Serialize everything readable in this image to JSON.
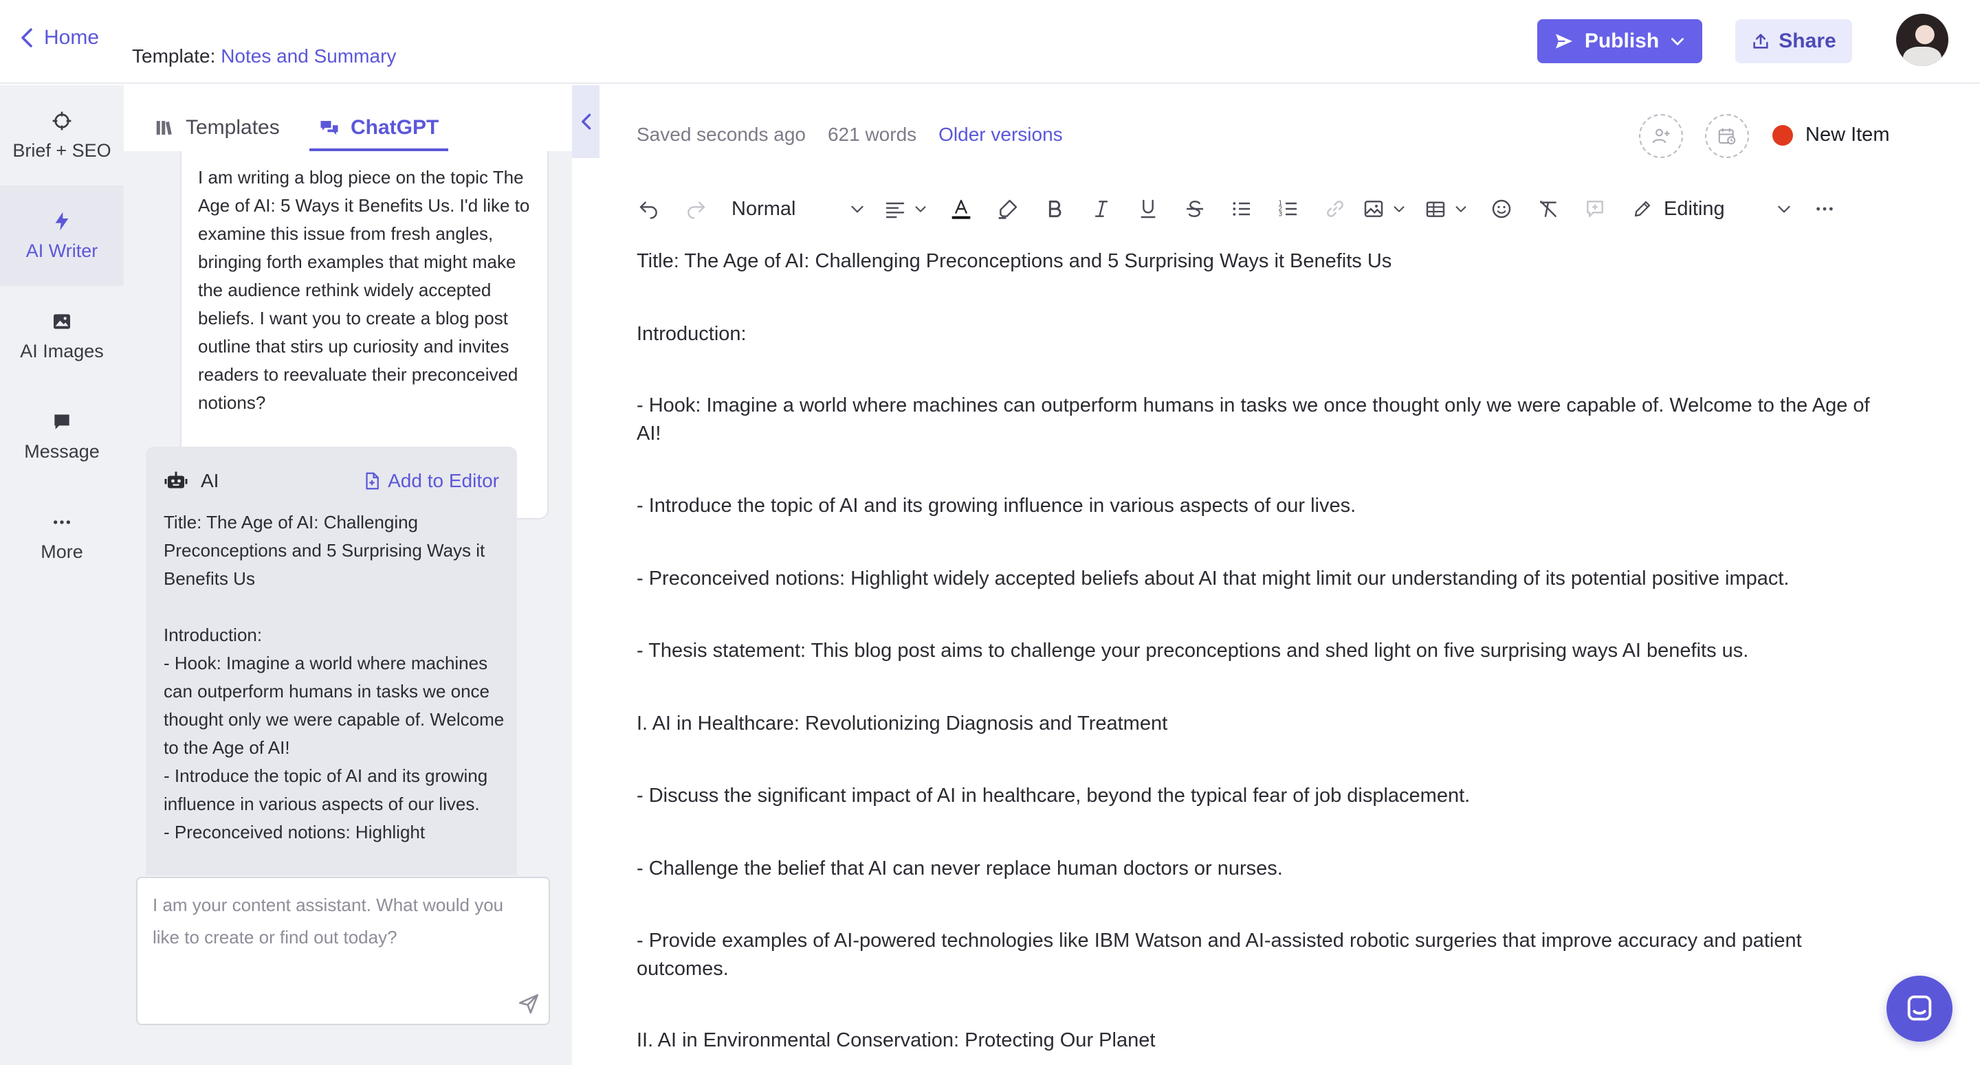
{
  "header": {
    "home_label": "Home",
    "template_prefix": "Template:",
    "template_name": "Notes and Summary",
    "publish_label": "Publish",
    "share_label": "Share"
  },
  "rail": {
    "items": [
      {
        "label": "Brief + SEO",
        "icon": "crosshair-icon"
      },
      {
        "label": "AI Writer",
        "icon": "lightning-icon"
      },
      {
        "label": "AI Images",
        "icon": "image-icon"
      },
      {
        "label": "Message",
        "icon": "message-icon"
      },
      {
        "label": "More",
        "icon": "more-dots-icon"
      }
    ]
  },
  "panel": {
    "tabs": [
      {
        "label": "Templates",
        "icon": "library-icon"
      },
      {
        "label": "ChatGPT",
        "icon": "chat-icon"
      }
    ],
    "user_message": "I am writing a blog piece on the topic The Age of AI: 5 Ways it Benefits Us. I'd like to examine this issue from fresh angles, bringing forth examples that might make the audience rethink widely accepted beliefs. I want you to create a blog post outline that stirs up curiosity and invites readers to reevaluate their preconceived notions?",
    "ai_label": "AI",
    "add_to_editor_label": "Add to Editor",
    "ai_message": "Title: The Age of AI: Challenging Preconceptions and 5 Surprising Ways it Benefits Us\n\nIntroduction:\n- Hook: Imagine a world where machines can outperform humans in tasks we once thought only we were capable of. Welcome to the Age of AI!\n- Introduce the topic of AI and its growing influence in various aspects of our lives.\n- Preconceived notions: Highlight",
    "input_placeholder": "I am your content assistant. What would you like to create or find out today?"
  },
  "editor": {
    "saved_status": "Saved seconds ago",
    "word_count": "621 words",
    "older_versions_label": "Older versions",
    "item_status_label": "New Item",
    "item_status_color": "#e0391d",
    "block_style": "Normal",
    "mode": "Editing",
    "doc_paragraphs": [
      "Title: The Age of AI: Challenging Preconceptions and 5 Surprising Ways it Benefits Us",
      "Introduction:",
      "- Hook: Imagine a world where machines can outperform humans in tasks we once thought only we were capable of. Welcome to the Age of AI!",
      "- Introduce the topic of AI and its growing influence in various aspects of our lives.",
      "- Preconceived notions: Highlight widely accepted beliefs about AI that might limit our understanding of its potential positive impact.",
      "- Thesis statement: This blog post aims to challenge your preconceptions and shed light on five surprising ways AI benefits us.",
      "I. AI in Healthcare: Revolutionizing Diagnosis and Treatment",
      "- Discuss the significant impact of AI in healthcare, beyond the typical fear of job displacement.",
      "- Challenge the belief that AI can never replace human doctors or nurses.",
      "- Provide examples of AI-powered technologies like IBM Watson and AI-assisted robotic surgeries that improve accuracy and patient outcomes.",
      "II. AI in Environmental Conservation: Protecting Our Planet"
    ]
  },
  "colors": {
    "accent": "#5b57d9",
    "publish_bg": "#6661e8",
    "share_bg": "#e9eafb",
    "rail_bg": "#f0f1f5"
  }
}
